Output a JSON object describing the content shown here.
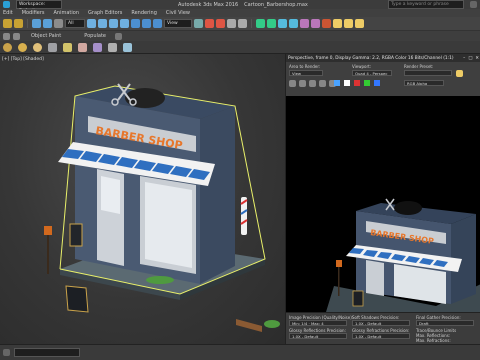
{
  "titlebar": {
    "workspace": "Workspace: Default",
    "app_title": "Autodesk 3ds Max 2016",
    "file_name": "Cartoon_Barbershop.max",
    "search_placeholder": "Type a keyword or phrase"
  },
  "menu": {
    "items": [
      "Edit",
      "Modifiers",
      "Animation",
      "Graph Editors",
      "Rendering",
      "Civil View"
    ]
  },
  "toolbar": {
    "selection_set": "View",
    "object_paint_label": "Object Paint",
    "populate_label": "Populate"
  },
  "viewport": {
    "label": "[+] [Top] [Shaded]"
  },
  "render_frame": {
    "title": "Perspective, frame 0, Display Gamma: 2.2, RGBA Color 16 Bits/Channel (1:1)",
    "area_to_render_label": "Area to Render:",
    "area_to_render_value": "View",
    "viewport_label": "Viewport:",
    "viewport_value": "Quad 4 - Perspec",
    "render_preset_label": "Render Preset:",
    "render_preset_value": "",
    "channel_value": "RGB Alpha",
    "image_precision_label": "Image Precision (Quality/Noise):",
    "image_precision_value": "Min: 1/4 · Max: 4",
    "gi_precision_label": "GI Precision (Quality/Noise):",
    "gi_precision_value": "1.0X - Default",
    "soft_shadows_label": "Soft Shadows Precision:",
    "soft_shadows_value": "1.0X - Default",
    "final_gather_label": "Final Gather Precision:",
    "final_gather_value": "Draft",
    "glossy_reflections_label": "Glossy Reflections Precision:",
    "glossy_reflections_value": "1.0X - Default",
    "glossy_refractions_label": "Glossy Refractions Precision:",
    "glossy_refractions_value": "1.0X - Default",
    "trace_bounce_label": "Trace/Bounce Limits",
    "max_reflections_label": "Max. Reflections:",
    "max_refractions_label": "Max. Refractions:"
  },
  "scene": {
    "sign_text": "BARBER SHOP",
    "colors": {
      "wall": "#4a5a72",
      "roof": "#3d4e68",
      "awning_stripe": "#2f6fc0",
      "sign_fill": "#e7772c",
      "selection": "#e9f06a"
    }
  }
}
